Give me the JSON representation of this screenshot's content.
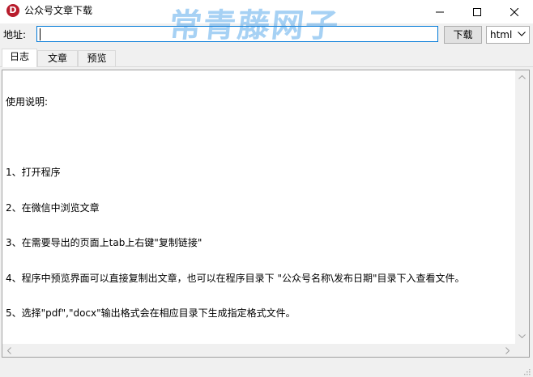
{
  "window": {
    "title": "公众号文章下载",
    "app_icon_letter": "D",
    "watermark": "常青藤网子"
  },
  "toolbar": {
    "address_label": "地址:",
    "address_value": "",
    "download_label": "下载",
    "format_value": "html"
  },
  "tabs": [
    {
      "label": "日志",
      "active": true
    },
    {
      "label": "文章",
      "active": false
    },
    {
      "label": "预览",
      "active": false
    }
  ],
  "log": {
    "lines": [
      "使用说明:",
      "",
      "1、打开程序",
      "2、在微信中浏览文章",
      "3、在需要导出的页面上tab上右键\"复制链接\"",
      "4、程序中预览界面可以直接复制出文章，也可以在程序目录下 \"公众号名称\\发布日期\"目录下入查看文件。",
      "5、选择\"pdf\",\"docx\"输出格式会在相应目录下生成指定格式文件。"
    ]
  },
  "icons": {
    "minimize": "minimize-icon",
    "maximize": "maximize-icon",
    "close": "close-icon",
    "dropdown": "chevron-down-icon",
    "scroll_up": "arrow-up-icon",
    "scroll_down": "arrow-down-icon",
    "scroll_left": "arrow-left-icon",
    "scroll_right": "arrow-right-icon",
    "resize": "resize-grip-icon"
  },
  "colors": {
    "app_icon": "#b81c2c",
    "watermark": "#2e92e6",
    "focus_border": "#0078d7"
  }
}
